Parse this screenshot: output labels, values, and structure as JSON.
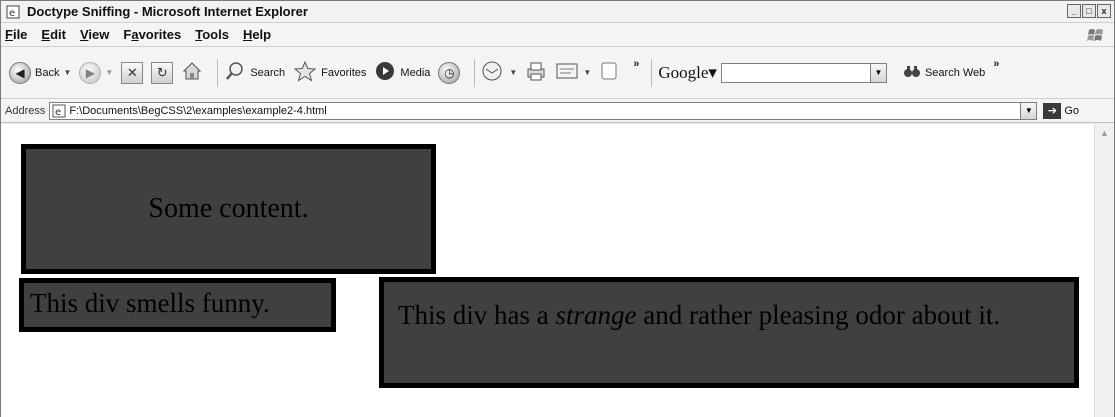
{
  "window": {
    "title": "Doctype Sniffing - Microsoft Internet Explorer",
    "controls": {
      "minimize": "_",
      "maximize": "□",
      "close": "x"
    }
  },
  "menubar": {
    "items": [
      {
        "underline": "F",
        "rest": "ile"
      },
      {
        "underline": "E",
        "rest": "dit"
      },
      {
        "underline": "V",
        "rest": "iew"
      },
      {
        "pre": "F",
        "underline": "a",
        "rest": "vorites"
      },
      {
        "underline": "T",
        "rest": "ools"
      },
      {
        "underline": "H",
        "rest": "elp"
      }
    ]
  },
  "toolbar": {
    "back_label": "Back",
    "search_label": "Search",
    "favorites_label": "Favorites",
    "media_label": "Media",
    "chevron": "»",
    "google_label": "Google▾",
    "google_search_value": "",
    "search_web_label": "Search Web",
    "icons": [
      "back-arrow-icon",
      "forward-arrow-icon",
      "stop-icon",
      "refresh-icon",
      "home-icon",
      "search-icon",
      "favorites-star-icon",
      "media-icon",
      "history-icon",
      "mail-icon",
      "print-icon",
      "edit-icon",
      "discuss-icon",
      "binoculars-icon"
    ]
  },
  "addressbar": {
    "label": "Address",
    "url": "F:\\Documents\\BegCSS\\2\\examples\\example2-4.html",
    "go_label": "Go"
  },
  "content": {
    "box1_text": "Some content.",
    "box2_text": "This div smells funny.",
    "box3_before": "This div has a ",
    "box3_emphasis": "strange",
    "box3_after": " and rather pleasing odor about it."
  },
  "colors": {
    "box_fill": "#404040",
    "box_border": "#000000",
    "page_background": "#ffffff"
  }
}
